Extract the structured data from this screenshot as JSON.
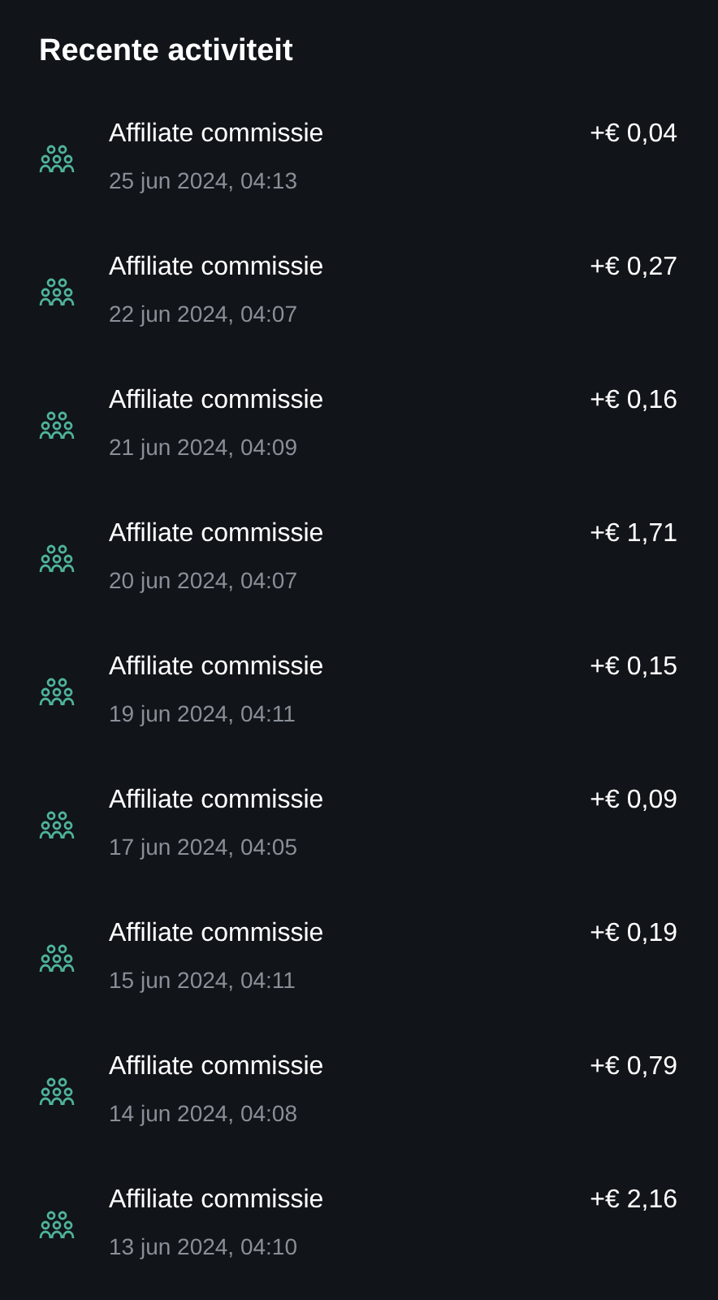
{
  "title": "Recente activiteit",
  "items": [
    {
      "label": "Affiliate commissie",
      "date": "25 jun 2024, 04:13",
      "amount": "+€ 0,04"
    },
    {
      "label": "Affiliate commissie",
      "date": "22 jun 2024, 04:07",
      "amount": "+€ 0,27"
    },
    {
      "label": "Affiliate commissie",
      "date": "21 jun 2024, 04:09",
      "amount": "+€ 0,16"
    },
    {
      "label": "Affiliate commissie",
      "date": "20 jun 2024, 04:07",
      "amount": "+€ 1,71"
    },
    {
      "label": "Affiliate commissie",
      "date": "19 jun 2024, 04:11",
      "amount": "+€ 0,15"
    },
    {
      "label": "Affiliate commissie",
      "date": "17 jun 2024, 04:05",
      "amount": "+€ 0,09"
    },
    {
      "label": "Affiliate commissie",
      "date": "15 jun 2024, 04:11",
      "amount": "+€ 0,19"
    },
    {
      "label": "Affiliate commissie",
      "date": "14 jun 2024, 04:08",
      "amount": "+€ 0,79"
    },
    {
      "label": "Affiliate commissie",
      "date": "13 jun 2024, 04:10",
      "amount": "+€ 2,16"
    }
  ]
}
